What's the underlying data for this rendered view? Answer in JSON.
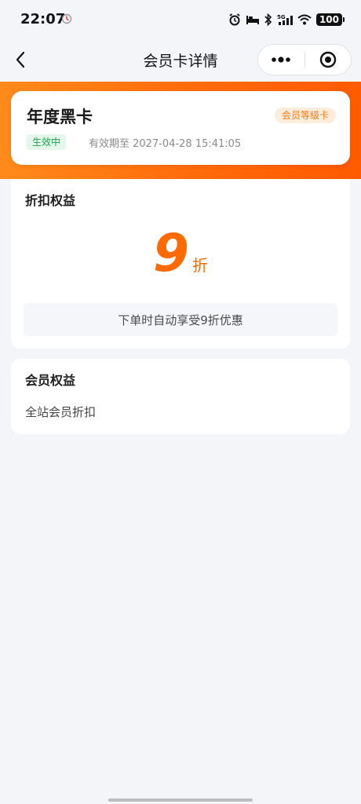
{
  "status_bar": {
    "time": "22:07",
    "battery": "100",
    "signal_label": "5G"
  },
  "nav": {
    "title": "会员卡详情"
  },
  "card": {
    "name": "年度黑卡",
    "tier_badge": "会员等级卡",
    "status_badge": "生效中",
    "validity": "有效期至 2027-04-28 15:41:05"
  },
  "discount": {
    "title": "折扣权益",
    "value": "9",
    "unit": "折",
    "note": "下单时自动享受9折优惠"
  },
  "benefits": {
    "title": "会员权益",
    "items": [
      "全站会员折扣"
    ]
  },
  "colors": {
    "brand_orange": "#ff6a00",
    "badge_green": "#1fa04f",
    "badge_orange": "#f07a15"
  }
}
